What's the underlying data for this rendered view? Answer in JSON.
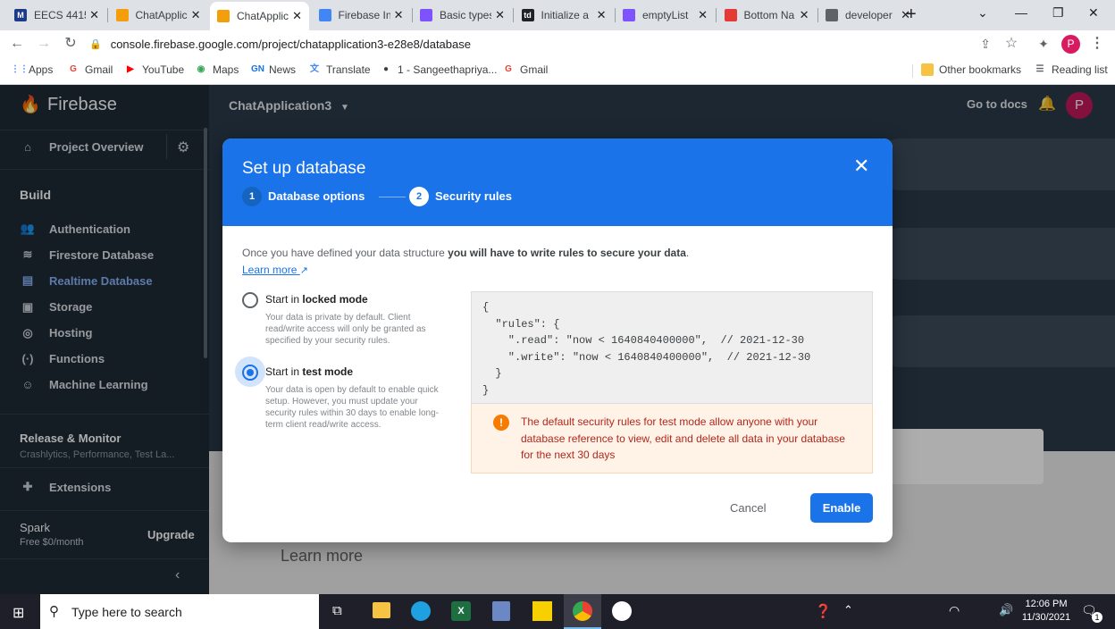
{
  "browser": {
    "tabs": [
      {
        "title": "EECS 4415",
        "fav_color": "#1e3a8a",
        "fav_text": "M",
        "active": false
      },
      {
        "title": "ChatApplic",
        "fav_color": "#f59e0b",
        "fav_text": "",
        "active": false
      },
      {
        "title": "ChatApplic",
        "fav_color": "#f59e0b",
        "fav_text": "",
        "active": true
      },
      {
        "title": "Firebase In",
        "fav_color": "#4285f4",
        "fav_text": "",
        "active": false
      },
      {
        "title": "Basic types",
        "fav_color": "#7f52ff",
        "fav_text": "",
        "active": false
      },
      {
        "title": "Initialize a",
        "fav_color": "#202124",
        "fav_text": "td",
        "active": false
      },
      {
        "title": "emptyList",
        "fav_color": "#7f52ff",
        "fav_text": "",
        "active": false
      },
      {
        "title": "Bottom Na",
        "fav_color": "#e53935",
        "fav_text": "",
        "active": false
      },
      {
        "title": "developer",
        "fav_color": "#5f6368",
        "fav_text": "",
        "active": false
      }
    ],
    "new_tab": "+",
    "url": "console.firebase.google.com/project/chatapplication3-e28e8/database",
    "profile_initial": "P"
  },
  "bookmarks": {
    "items": [
      {
        "label": "Apps",
        "icon_color": "#4285f4",
        "icon": "grid-icon"
      },
      {
        "label": "Gmail",
        "icon_color": "#ea4335",
        "icon": "google-icon",
        "glyph": "G"
      },
      {
        "label": "YouTube",
        "icon_color": "#ff0000",
        "icon": "youtube-icon",
        "glyph": "▶"
      },
      {
        "label": "Maps",
        "icon_color": "#34a853",
        "icon": "maps-icon",
        "glyph": "◉"
      },
      {
        "label": "News",
        "icon_color": "#1a73e8",
        "icon": "news-icon",
        "glyph": "GN"
      },
      {
        "label": "Translate",
        "icon_color": "#4285f4",
        "icon": "translate-icon",
        "glyph": "文"
      },
      {
        "label": "1 - Sangeethapriya...",
        "icon_color": "#3c4043",
        "icon": "github-icon",
        "glyph": "●"
      },
      {
        "label": "Gmail",
        "icon_color": "#ea4335",
        "icon": "google-icon",
        "glyph": "G"
      }
    ],
    "other": "Other bookmarks",
    "reading": "Reading list"
  },
  "firebase": {
    "brand": "Firebase",
    "project": "ChatApplication3",
    "go_to_docs": "Go to docs",
    "avatar": "P",
    "sidebar": {
      "overview": "Project Overview",
      "build_header": "Build",
      "build_items": [
        {
          "label": "Authentication",
          "icon": "people-icon",
          "glyph": "👥"
        },
        {
          "label": "Firestore Database",
          "icon": "firestore-icon",
          "glyph": "≋"
        },
        {
          "label": "Realtime Database",
          "icon": "database-icon",
          "glyph": "▤",
          "selected": true
        },
        {
          "label": "Storage",
          "icon": "storage-icon",
          "glyph": "▣"
        },
        {
          "label": "Hosting",
          "icon": "hosting-icon",
          "glyph": "◎"
        },
        {
          "label": "Functions",
          "icon": "functions-icon",
          "glyph": "(·)"
        },
        {
          "label": "Machine Learning",
          "icon": "robot-icon",
          "glyph": "☺"
        }
      ],
      "release_header": "Release & Monitor",
      "release_sub": "Crashlytics, Performance, Test La...",
      "extensions": "Extensions",
      "plan": "Spark",
      "plan_price": "Free $0/month",
      "upgrade": "Upgrade"
    },
    "learn_more": "Learn more"
  },
  "dialog": {
    "title": "Set up database",
    "step1_num": "1",
    "step1_label": "Database options",
    "step2_num": "2",
    "step2_label": "Security rules",
    "intro_plain": "Once you have defined your data structure ",
    "intro_bold": "you will have to write rules to secure your data",
    "intro_end": ".",
    "learn_more": "Learn more",
    "locked_prefix": "Start in ",
    "locked_bold": "locked mode",
    "locked_desc": "Your data is private by default. Client read/write access will only be granted as specified by your security rules.",
    "test_prefix": "Start in ",
    "test_bold": "test mode",
    "test_desc": "Your data is open by default to enable quick setup. However, you must update your security rules within 30 days to enable long-term client read/write access.",
    "selected_mode": "test",
    "code_lines": [
      "{",
      "  \"rules\": {",
      "    \".read\": \"now < 1640840400000\",  // 2021-12-30",
      "    \".write\": \"now < 1640840400000\",  // 2021-12-30",
      "  }",
      "}"
    ],
    "warning": "The default security rules for test mode allow anyone with your database reference to view, edit and delete all data in your database for the next 30 days",
    "cancel": "Cancel",
    "enable": "Enable"
  },
  "taskbar": {
    "search_placeholder": "Type here to search",
    "time": "12:06 PM",
    "date": "11/30/2021",
    "notif_count": "1"
  }
}
